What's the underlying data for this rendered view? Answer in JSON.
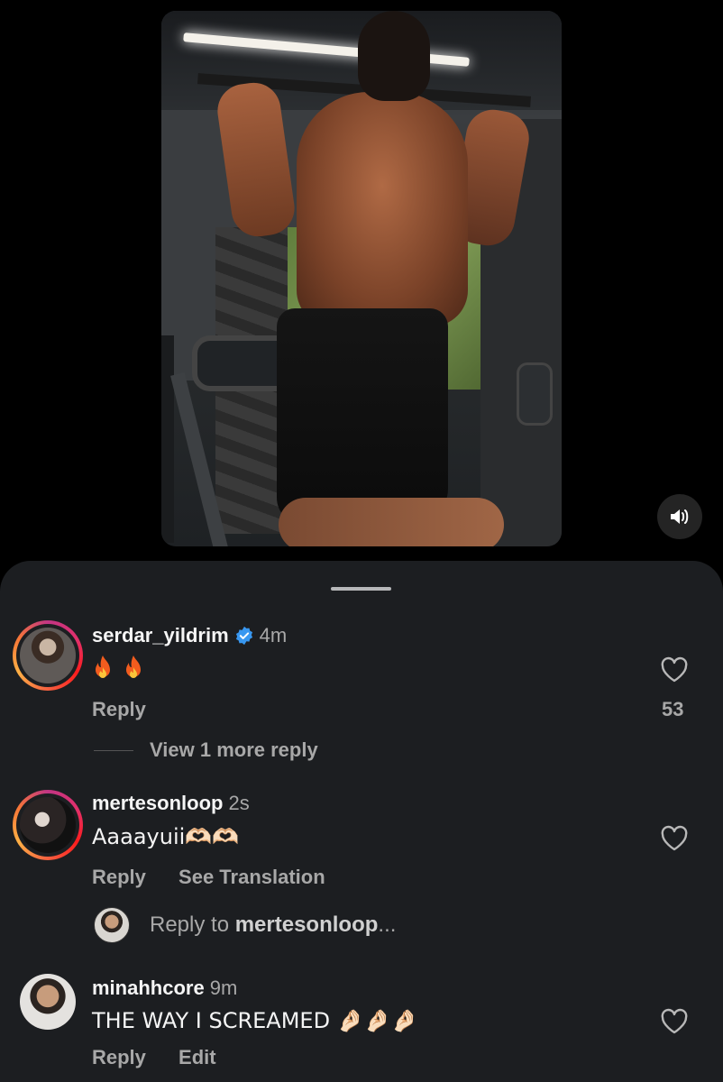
{
  "video": {
    "sound_icon": "speaker-icon"
  },
  "comments": [
    {
      "username": "serdar_yildrim",
      "verified": true,
      "time": "4m",
      "text": "🔥 🔥",
      "reply_label": "Reply",
      "like_count": "53",
      "view_more": "View 1 more reply"
    },
    {
      "username": "mertesonloop",
      "time": "2s",
      "text": "Aaaayuii🫶🏻🫶🏻",
      "reply_label": "Reply",
      "translate_label": "See Translation",
      "reply_input_prefix": "Reply to ",
      "reply_input_user": "mertesonloop",
      "reply_input_suffix": "..."
    },
    {
      "username": "minahhcore",
      "time": "9m",
      "text": "THE WAY I SCREAMED 🤌🏻🤌🏻🤌🏻",
      "reply_label": "Reply",
      "edit_label": "Edit"
    }
  ],
  "colors": {
    "background": "#000000",
    "sheet": "#1c1e21",
    "secondary_text": "#a8a8a8",
    "verified_blue": "#3897f0"
  }
}
